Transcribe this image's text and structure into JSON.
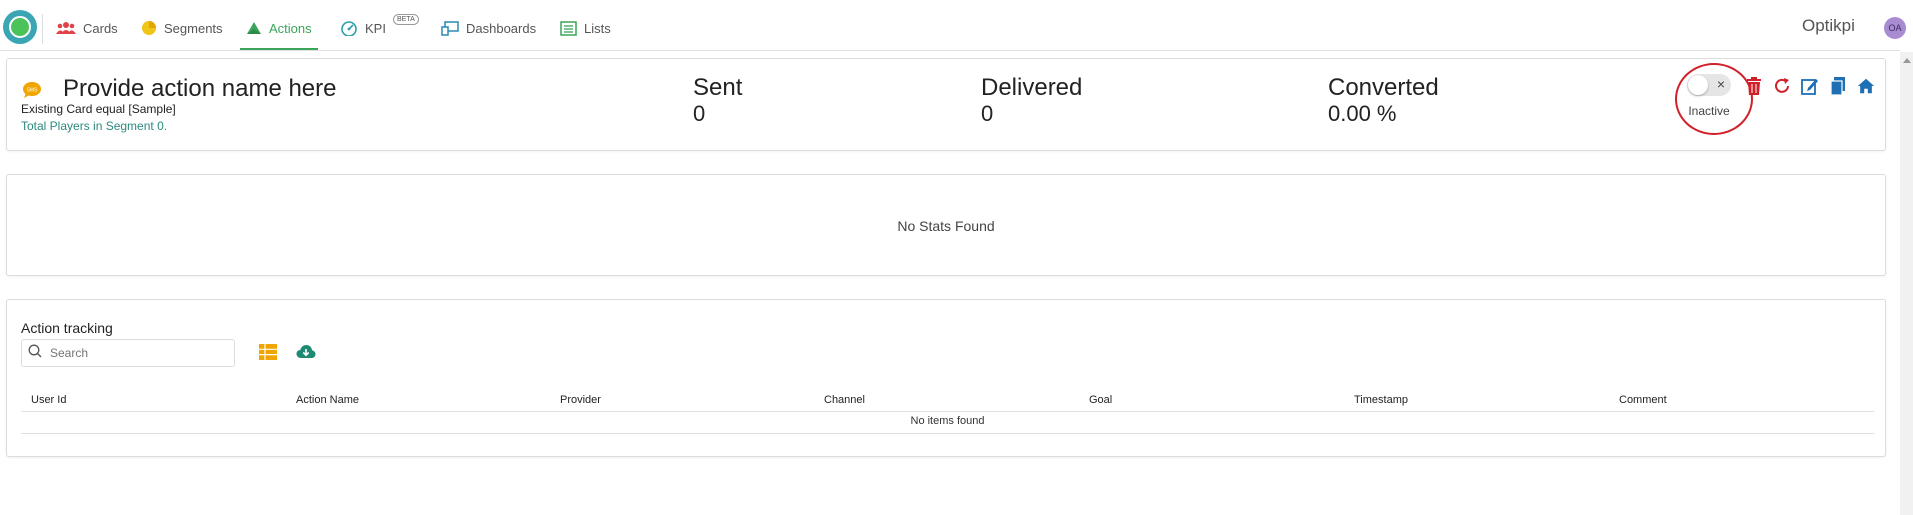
{
  "nav": {
    "tabs": [
      {
        "label": "Cards",
        "icon": "users-icon"
      },
      {
        "label": "Segments",
        "icon": "pie-icon"
      },
      {
        "label": "Actions",
        "icon": "actions-icon"
      },
      {
        "label": "KPI",
        "icon": "gauge-icon",
        "badge": "BETA"
      },
      {
        "label": "Dashboards",
        "icon": "dashboard-icon"
      },
      {
        "label": "Lists",
        "icon": "list-icon"
      }
    ],
    "active_tab": "Actions",
    "brand": "Optikpi",
    "avatar_initials": "OA"
  },
  "colors": {
    "accent_green": "#3aa55a",
    "link_teal": "#2a8a7e",
    "icon_blue": "#1f6fb5",
    "delete_red": "#d0202a",
    "icon_orange": "#f0a500"
  },
  "action": {
    "name": "Provide action name here",
    "condition": "Existing Card equal [Sample]",
    "segment_info": "Total Players in Segment 0.",
    "stats": [
      {
        "label": "Sent",
        "value": "0"
      },
      {
        "label": "Delivered",
        "value": "0"
      },
      {
        "label": "Converted",
        "value": "0.00 %"
      }
    ],
    "status_label": "Inactive",
    "toolbar_icons": [
      "trash-icon",
      "refresh-icon",
      "edit-icon",
      "copy-icon",
      "home-icon"
    ]
  },
  "stats_panel": {
    "empty_text": "No Stats Found"
  },
  "tracking": {
    "title": "Action tracking",
    "search_placeholder": "Search",
    "columns": [
      "User Id",
      "Action Name",
      "Provider",
      "Channel",
      "Goal",
      "Timestamp",
      "Comment"
    ],
    "empty_text": "No items found"
  }
}
